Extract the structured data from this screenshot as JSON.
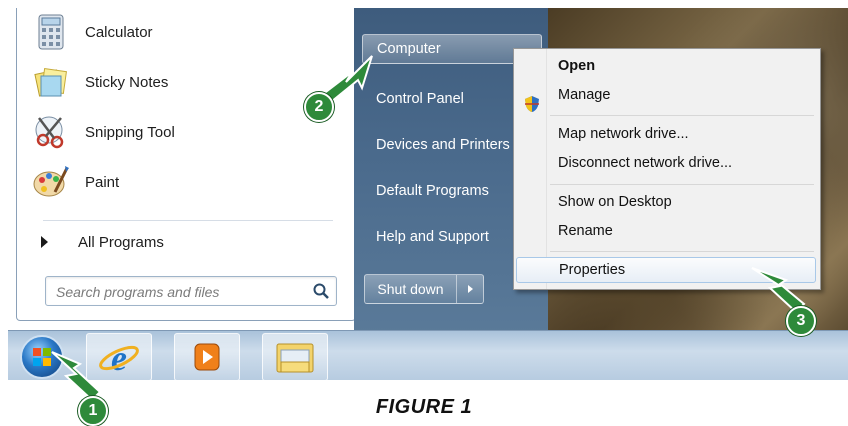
{
  "programs": [
    {
      "label": "Calculator",
      "icon": "calculator-icon"
    },
    {
      "label": "Sticky Notes",
      "icon": "sticky-notes-icon"
    },
    {
      "label": "Snipping Tool",
      "icon": "snipping-tool-icon"
    },
    {
      "label": "Paint",
      "icon": "paint-icon"
    }
  ],
  "all_programs": "All Programs",
  "search": {
    "placeholder": "Search programs and files"
  },
  "right_items": [
    "Computer",
    "Control Panel",
    "Devices and Printers",
    "Default Programs",
    "Help and Support"
  ],
  "shutdown": {
    "label": "Shut down"
  },
  "context_menu": {
    "open": "Open",
    "manage": "Manage",
    "map_drive": "Map network drive...",
    "disconnect_drive": "Disconnect network drive...",
    "show_on_desktop": "Show on Desktop",
    "rename": "Rename",
    "properties": "Properties"
  },
  "callouts": [
    "1",
    "2",
    "3"
  ],
  "caption": "FIGURE 1",
  "colors": {
    "callout_green": "#2e8a3a",
    "menu_blue": "#4a6a8c"
  }
}
